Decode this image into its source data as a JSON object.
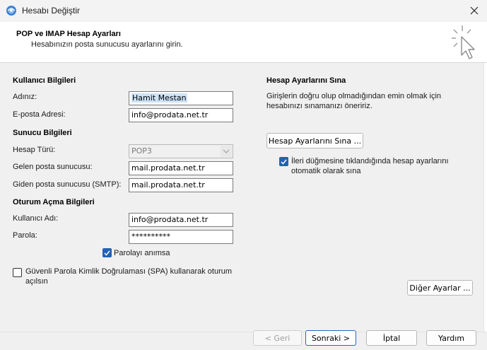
{
  "window": {
    "title": "Hesabı Değiştir",
    "icons": {
      "app": "mail-account-icon",
      "close": "close-icon"
    }
  },
  "header": {
    "title": "POP ve IMAP Hesap Ayarları",
    "subtitle": "Hesabınızın posta sunucusu ayarlarını girin.",
    "icon": "pointer-click-icon"
  },
  "user_info": {
    "section": "Kullanıcı Bilgileri",
    "name_label": "Adınız:",
    "name_value": "Hamit Mestan",
    "email_label": "E-posta Adresi:",
    "email_value": "info@prodata.net.tr"
  },
  "server_info": {
    "section": "Sunucu Bilgileri",
    "account_type_label": "Hesap Türü:",
    "account_type_value": "POP3",
    "incoming_label": "Gelen posta sunucusu:",
    "incoming_value": "mail.prodata.net.tr",
    "outgoing_label": "Giden posta sunucusu (SMTP):",
    "outgoing_value": "mail.prodata.net.tr"
  },
  "login_info": {
    "section": "Oturum Açma Bilgileri",
    "username_label": "Kullanıcı Adı:",
    "username_value": "info@prodata.net.tr",
    "password_label": "Parola:",
    "password_value": "**********",
    "remember_label": "Parolayı anımsa",
    "remember_checked": true,
    "spa_label_line1": "Güvenli Parola Kimlik Doğrulaması (SPA) kullanarak oturum",
    "spa_label_line2": "açılsın",
    "spa_checked": false
  },
  "test_settings": {
    "section": "Hesap Ayarlarını Sına",
    "description_line1": "Girişlerin doğru olup olmadığından emin olmak için",
    "description_line2": "hesabınızı sınamanızı öneririz.",
    "test_button": "Hesap Ayarlarını Sına ...",
    "auto_test_line1": "İleri düğmesine tıklandığında hesap ayarlarını",
    "auto_test_line2": "otomatik olarak sına",
    "auto_test_checked": true,
    "more_settings_button": "Diğer Ayarlar ..."
  },
  "footer": {
    "back": "< Geri",
    "next": "Sonraki >",
    "cancel": "İptal",
    "help": "Yardım"
  },
  "colors": {
    "accent": "#2062b6",
    "selection": "#cde3f7"
  }
}
